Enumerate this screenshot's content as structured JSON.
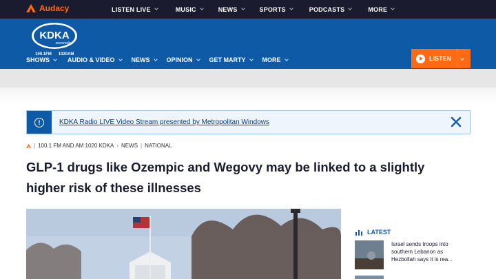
{
  "topbar": {
    "brand": "Audacy",
    "nav": [
      "LISTEN LIVE",
      "MUSIC",
      "NEWS",
      "SPORTS",
      "PODCASTS",
      "MORE"
    ]
  },
  "station": {
    "logo_text": "KDKA",
    "logo_sub": "newsradio",
    "freq_fm": "100.1FM",
    "freq_am": "1020AM",
    "nav": [
      "SHOWS",
      "AUDIO & VIDEO",
      "NEWS",
      "OPINION",
      "GET MARTY",
      "MORE"
    ],
    "listen_label": "LISTEN"
  },
  "alert": {
    "text": "KDKA Radio LIVE Video Stream presented by Metropolitan Windows"
  },
  "breadcrumb": {
    "source": "100.1 FM AND AM 1020 KDKA",
    "section": "NEWS",
    "subsection": "NATIONAL"
  },
  "article": {
    "headline": "GLP-1 drugs like Ozempic and Wegovy may be linked to a slightly higher risk of these illnesses"
  },
  "sidebar": {
    "latest_label": "LATEST",
    "stories": [
      {
        "title": "Israel sends troops into southern Lebanon as Hezbollah says it is rea..."
      }
    ]
  },
  "colors": {
    "topbar": "#1b1b2f",
    "brand_orange": "#ff6a13",
    "station_blue": "#0e5aa7"
  }
}
